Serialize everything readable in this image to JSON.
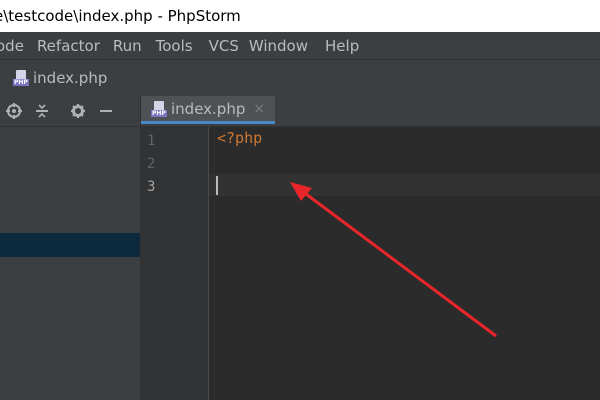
{
  "window": {
    "title": "e\\testcode\\index.php - PhpStorm"
  },
  "menu": [
    "ode",
    "Refactor",
    "Run",
    "Tools",
    "VCS",
    "Window",
    "Help"
  ],
  "breadcrumb": {
    "file": "index.php",
    "icon": "php-file-icon"
  },
  "tab": {
    "label": "index.php",
    "close": "×"
  },
  "editor": {
    "line_numbers": [
      "1",
      "2",
      "3"
    ],
    "code_line_1": "<?php",
    "current_line": 3
  },
  "colors": {
    "accent": "#4a88c7",
    "keyword": "#cc7832",
    "annotation_arrow": "#e8262a"
  }
}
